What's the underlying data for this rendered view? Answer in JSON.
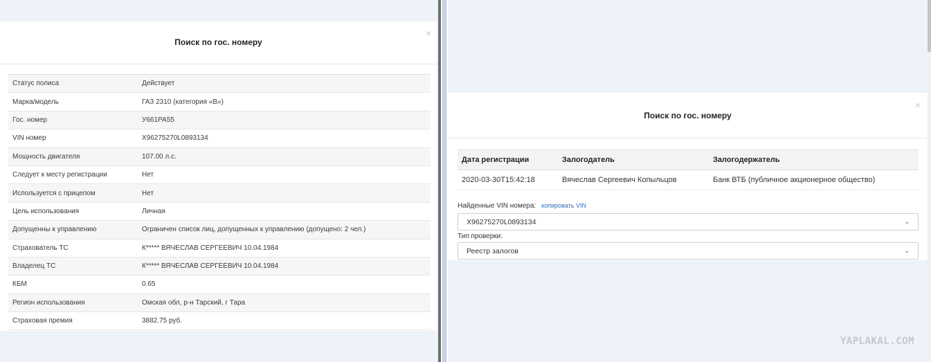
{
  "left_modal": {
    "title": "Поиск по гос. номеру",
    "close": "×",
    "rows": [
      {
        "label": "Статус полиса",
        "value": "Действует"
      },
      {
        "label": "Марка/модель",
        "value": "ГАЗ 2310 (категория «B»)"
      },
      {
        "label": "Гос. номер",
        "value": "У661РА55"
      },
      {
        "label": "VIN номер",
        "value": "X96275270L0893134"
      },
      {
        "label": "Мощность двигателя",
        "value": "107.00 л.с."
      },
      {
        "label": "Следует к месту регистрации",
        "value": "Нет"
      },
      {
        "label": "Используется с прицепом",
        "value": "Нет"
      },
      {
        "label": "Цель использования",
        "value": "Личная"
      },
      {
        "label": "Допущенны к управлению",
        "value": "Ограничен список лиц, допущенных к управлению (допущено: 2 чел.)"
      },
      {
        "label": "Страхователь ТС",
        "value": "К***** ВЯЧЕСЛАВ СЕРГЕЕВИЧ 10.04.1984"
      },
      {
        "label": "Владелец ТС",
        "value": "К***** ВЯЧЕСЛАВ СЕРГЕЕВИЧ 10.04.1984"
      },
      {
        "label": "КБМ",
        "value": "0.65"
      },
      {
        "label": "Регион использования",
        "value": "Омская обл, р-н Тарский, г Тара"
      },
      {
        "label": "Страховая премия",
        "value": "3882.75 руб."
      }
    ]
  },
  "right_modal": {
    "title": "Поиск по гос. номеру",
    "close": "×",
    "table": {
      "headers": [
        "Дата регистрации",
        "Залогодатель",
        "Залогодержатель"
      ],
      "rows": [
        [
          "2020-03-30T15:42:18",
          "Вячеслав Сергеевич Копыльцов",
          "Банк ВТБ (публичное акционерное общество)"
        ]
      ]
    },
    "vin_label": "Найденные VIN номера:",
    "copy_vin": "копировать VIN",
    "vin_value": "X96275270L0893134",
    "type_label": "Тип проверки:",
    "type_value": "Реестр залогов"
  },
  "watermark": "YAPLAKAL.COM",
  "icons": {
    "close": "close-icon",
    "chevron": "chevron-down-icon"
  }
}
